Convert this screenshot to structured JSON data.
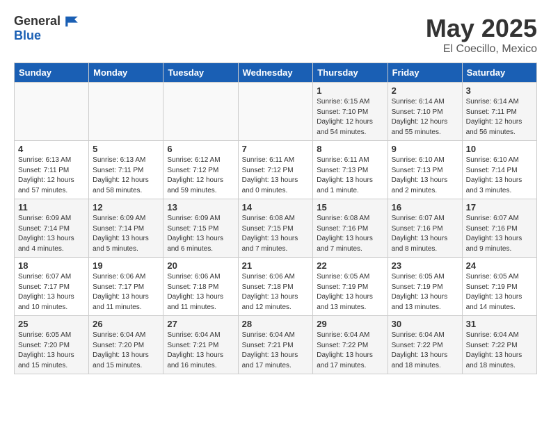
{
  "header": {
    "logo_general": "General",
    "logo_blue": "Blue",
    "month_year": "May 2025",
    "location": "El Coecillo, Mexico"
  },
  "columns": [
    "Sunday",
    "Monday",
    "Tuesday",
    "Wednesday",
    "Thursday",
    "Friday",
    "Saturday"
  ],
  "weeks": [
    [
      {
        "day": "",
        "info": ""
      },
      {
        "day": "",
        "info": ""
      },
      {
        "day": "",
        "info": ""
      },
      {
        "day": "",
        "info": ""
      },
      {
        "day": "1",
        "info": "Sunrise: 6:15 AM\nSunset: 7:10 PM\nDaylight: 12 hours\nand 54 minutes."
      },
      {
        "day": "2",
        "info": "Sunrise: 6:14 AM\nSunset: 7:10 PM\nDaylight: 12 hours\nand 55 minutes."
      },
      {
        "day": "3",
        "info": "Sunrise: 6:14 AM\nSunset: 7:11 PM\nDaylight: 12 hours\nand 56 minutes."
      }
    ],
    [
      {
        "day": "4",
        "info": "Sunrise: 6:13 AM\nSunset: 7:11 PM\nDaylight: 12 hours\nand 57 minutes."
      },
      {
        "day": "5",
        "info": "Sunrise: 6:13 AM\nSunset: 7:11 PM\nDaylight: 12 hours\nand 58 minutes."
      },
      {
        "day": "6",
        "info": "Sunrise: 6:12 AM\nSunset: 7:12 PM\nDaylight: 12 hours\nand 59 minutes."
      },
      {
        "day": "7",
        "info": "Sunrise: 6:11 AM\nSunset: 7:12 PM\nDaylight: 13 hours\nand 0 minutes."
      },
      {
        "day": "8",
        "info": "Sunrise: 6:11 AM\nSunset: 7:13 PM\nDaylight: 13 hours\nand 1 minute."
      },
      {
        "day": "9",
        "info": "Sunrise: 6:10 AM\nSunset: 7:13 PM\nDaylight: 13 hours\nand 2 minutes."
      },
      {
        "day": "10",
        "info": "Sunrise: 6:10 AM\nSunset: 7:14 PM\nDaylight: 13 hours\nand 3 minutes."
      }
    ],
    [
      {
        "day": "11",
        "info": "Sunrise: 6:09 AM\nSunset: 7:14 PM\nDaylight: 13 hours\nand 4 minutes."
      },
      {
        "day": "12",
        "info": "Sunrise: 6:09 AM\nSunset: 7:14 PM\nDaylight: 13 hours\nand 5 minutes."
      },
      {
        "day": "13",
        "info": "Sunrise: 6:09 AM\nSunset: 7:15 PM\nDaylight: 13 hours\nand 6 minutes."
      },
      {
        "day": "14",
        "info": "Sunrise: 6:08 AM\nSunset: 7:15 PM\nDaylight: 13 hours\nand 7 minutes."
      },
      {
        "day": "15",
        "info": "Sunrise: 6:08 AM\nSunset: 7:16 PM\nDaylight: 13 hours\nand 7 minutes."
      },
      {
        "day": "16",
        "info": "Sunrise: 6:07 AM\nSunset: 7:16 PM\nDaylight: 13 hours\nand 8 minutes."
      },
      {
        "day": "17",
        "info": "Sunrise: 6:07 AM\nSunset: 7:16 PM\nDaylight: 13 hours\nand 9 minutes."
      }
    ],
    [
      {
        "day": "18",
        "info": "Sunrise: 6:07 AM\nSunset: 7:17 PM\nDaylight: 13 hours\nand 10 minutes."
      },
      {
        "day": "19",
        "info": "Sunrise: 6:06 AM\nSunset: 7:17 PM\nDaylight: 13 hours\nand 11 minutes."
      },
      {
        "day": "20",
        "info": "Sunrise: 6:06 AM\nSunset: 7:18 PM\nDaylight: 13 hours\nand 11 minutes."
      },
      {
        "day": "21",
        "info": "Sunrise: 6:06 AM\nSunset: 7:18 PM\nDaylight: 13 hours\nand 12 minutes."
      },
      {
        "day": "22",
        "info": "Sunrise: 6:05 AM\nSunset: 7:19 PM\nDaylight: 13 hours\nand 13 minutes."
      },
      {
        "day": "23",
        "info": "Sunrise: 6:05 AM\nSunset: 7:19 PM\nDaylight: 13 hours\nand 13 minutes."
      },
      {
        "day": "24",
        "info": "Sunrise: 6:05 AM\nSunset: 7:19 PM\nDaylight: 13 hours\nand 14 minutes."
      }
    ],
    [
      {
        "day": "25",
        "info": "Sunrise: 6:05 AM\nSunset: 7:20 PM\nDaylight: 13 hours\nand 15 minutes."
      },
      {
        "day": "26",
        "info": "Sunrise: 6:04 AM\nSunset: 7:20 PM\nDaylight: 13 hours\nand 15 minutes."
      },
      {
        "day": "27",
        "info": "Sunrise: 6:04 AM\nSunset: 7:21 PM\nDaylight: 13 hours\nand 16 minutes."
      },
      {
        "day": "28",
        "info": "Sunrise: 6:04 AM\nSunset: 7:21 PM\nDaylight: 13 hours\nand 17 minutes."
      },
      {
        "day": "29",
        "info": "Sunrise: 6:04 AM\nSunset: 7:22 PM\nDaylight: 13 hours\nand 17 minutes."
      },
      {
        "day": "30",
        "info": "Sunrise: 6:04 AM\nSunset: 7:22 PM\nDaylight: 13 hours\nand 18 minutes."
      },
      {
        "day": "31",
        "info": "Sunrise: 6:04 AM\nSunset: 7:22 PM\nDaylight: 13 hours\nand 18 minutes."
      }
    ]
  ]
}
